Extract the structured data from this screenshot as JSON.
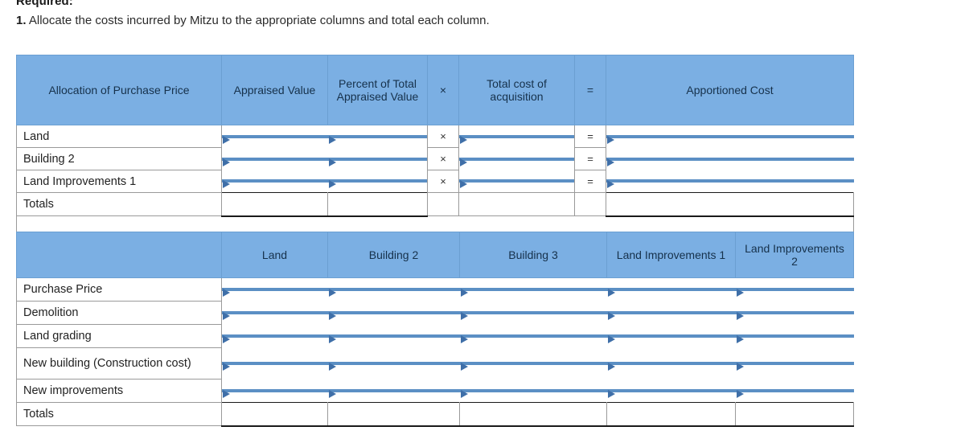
{
  "intro": {
    "required_label": "Required:",
    "question_number": "1.",
    "question_text": "Allocate the costs incurred by Mitzu to the appropriate columns and total each column."
  },
  "colors": {
    "header_blue": "#7bafe3",
    "input_border_blue": "#5b8fc4",
    "flag_blue": "#3f6fa8",
    "grid_gray": "#9a9a9a",
    "text": "#222222"
  },
  "table1": {
    "name": "allocation-of-purchase-price-table",
    "headers": [
      "Allocation of Purchase Price",
      "Appraised Value",
      "Percent of Total Appraised Value",
      "×",
      "Total cost of acquisition",
      "=",
      "Apportioned Cost"
    ],
    "operators": {
      "times": "×",
      "equals": "="
    },
    "rows": [
      {
        "label": "Land",
        "appraised_value": "",
        "percent_total": "",
        "times": "×",
        "total_cost": "",
        "equals": "=",
        "apportioned_cost": ""
      },
      {
        "label": "Building 2",
        "appraised_value": "",
        "percent_total": "",
        "times": "×",
        "total_cost": "",
        "equals": "=",
        "apportioned_cost": ""
      },
      {
        "label": "Land Improvements 1",
        "appraised_value": "",
        "percent_total": "",
        "times": "×",
        "total_cost": "",
        "equals": "=",
        "apportioned_cost": ""
      }
    ],
    "totals_row": {
      "label": "Totals",
      "appraised_value": "",
      "percent_total": "",
      "times": "",
      "total_cost": "",
      "equals": "",
      "apportioned_cost": ""
    }
  },
  "table2": {
    "name": "cost-allocation-by-asset-table",
    "headers": [
      "",
      "Land",
      "Building 2",
      "Building 3",
      "Land Improvements 1",
      "Land Improvements 2"
    ],
    "rows": [
      {
        "label": "Purchase Price",
        "land": "",
        "building2": "",
        "building3": "",
        "land_improvements_1": "",
        "land_improvements_2": ""
      },
      {
        "label": "Demolition",
        "land": "",
        "building2": "",
        "building3": "",
        "land_improvements_1": "",
        "land_improvements_2": ""
      },
      {
        "label": "Land grading",
        "land": "",
        "building2": "",
        "building3": "",
        "land_improvements_1": "",
        "land_improvements_2": ""
      },
      {
        "label": "New building (Construction cost)",
        "land": "",
        "building2": "",
        "building3": "",
        "land_improvements_1": "",
        "land_improvements_2": ""
      },
      {
        "label": "New improvements",
        "land": "",
        "building2": "",
        "building3": "",
        "land_improvements_1": "",
        "land_improvements_2": ""
      }
    ],
    "totals_row": {
      "label": "Totals",
      "land": "",
      "building2": "",
      "building3": "",
      "land_improvements_1": "",
      "land_improvements_2": ""
    }
  }
}
